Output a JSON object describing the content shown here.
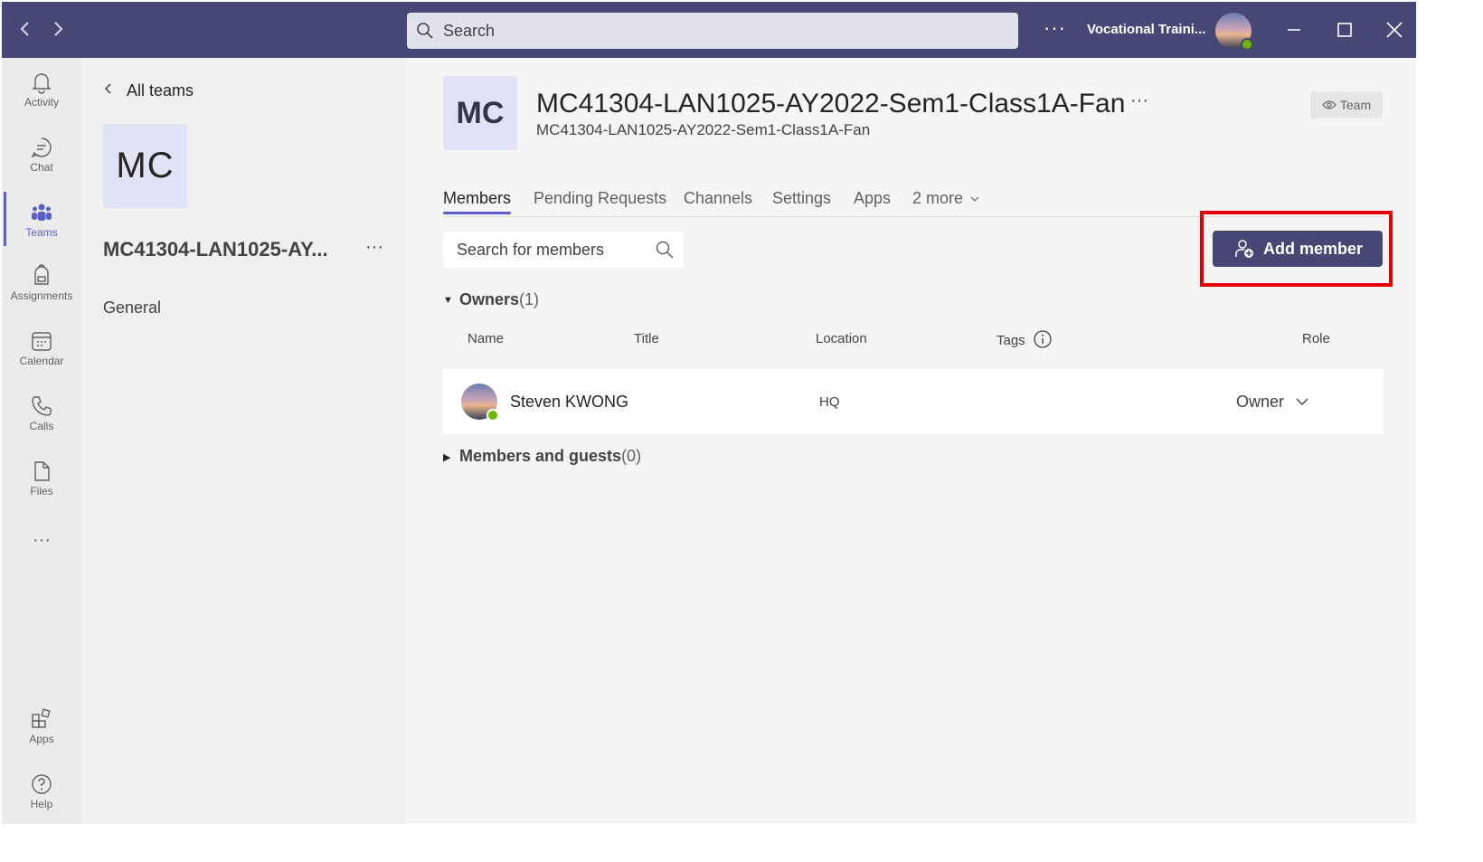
{
  "titlebar": {
    "back_icon": "chevron-left-icon",
    "forward_icon": "chevron-right-icon",
    "search_placeholder": "Search",
    "more_label": "···",
    "org_name": "Vocational Traini...",
    "window_controls": [
      "minimize",
      "maximize",
      "close"
    ]
  },
  "rail": {
    "items": [
      {
        "label": "Activity",
        "icon": "bell-icon"
      },
      {
        "label": "Chat",
        "icon": "chat-icon"
      },
      {
        "label": "Teams",
        "icon": "teams-icon",
        "active": true
      },
      {
        "label": "Assignments",
        "icon": "backpack-icon"
      },
      {
        "label": "Calendar",
        "icon": "calendar-icon"
      },
      {
        "label": "Calls",
        "icon": "phone-icon"
      },
      {
        "label": "Files",
        "icon": "file-icon"
      },
      {
        "label": "···",
        "icon": "more-icon"
      }
    ],
    "bottom_items": [
      {
        "label": "Apps",
        "icon": "apps-icon"
      },
      {
        "label": "Help",
        "icon": "help-icon"
      }
    ],
    "accent_color": "#5b5fc7"
  },
  "teampane": {
    "all_teams": "All teams",
    "tile_initials": "MC",
    "team_name": "MC41304-LAN1025-AY...",
    "more_label": "···",
    "channel": "General"
  },
  "main": {
    "tile_initials": "MC",
    "title": "MC41304-LAN1025-AY2022-Sem1-Class1A-Fan",
    "title_more": "···",
    "subtitle": "MC41304-LAN1025-AY2022-Sem1-Class1A-Fan",
    "team_badge": "Team",
    "tabs": [
      {
        "label": "Members",
        "active": true
      },
      {
        "label": "Pending Requests"
      },
      {
        "label": "Channels"
      },
      {
        "label": "Settings"
      },
      {
        "label": "Apps"
      },
      {
        "label": "2 more"
      }
    ],
    "member_search_placeholder": "Search for members",
    "add_member_label": "Add member",
    "owners": {
      "label": "Owners",
      "count": "(1)"
    },
    "columns": {
      "name": "Name",
      "title": "Title",
      "location": "Location",
      "tags": "Tags",
      "role": "Role"
    },
    "rows": [
      {
        "name": "Steven KWONG",
        "title": "",
        "location": "HQ",
        "role": "Owner"
      }
    ],
    "members_guests": {
      "label": "Members and guests",
      "count": "(0)"
    },
    "brand_color": "#464775",
    "highlight_color": "#e50000"
  }
}
